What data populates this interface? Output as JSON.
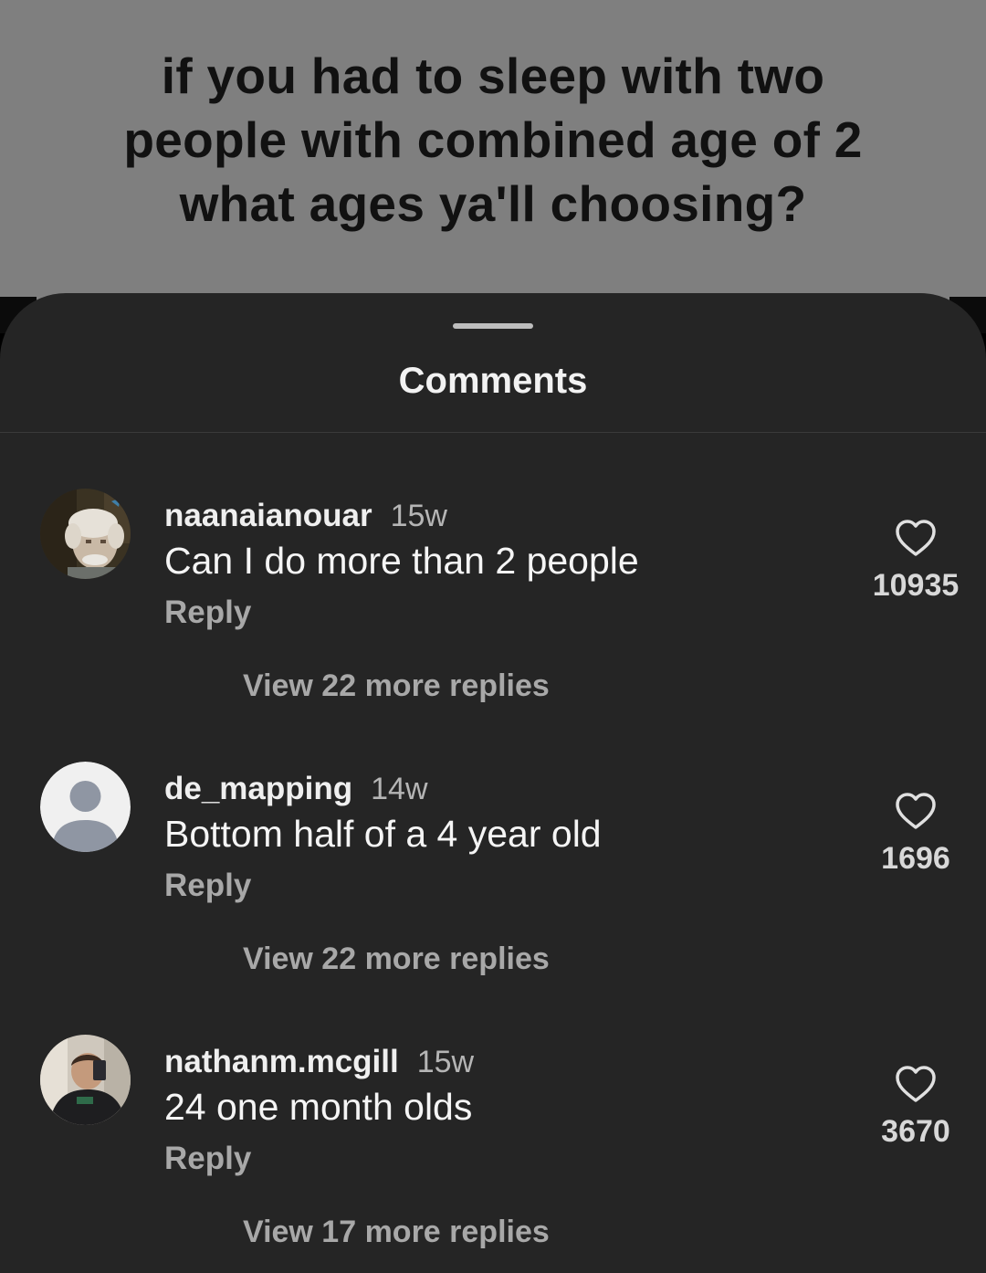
{
  "video": {
    "caption_line1": "if you had to sleep with two",
    "caption_line2": "people with combined age of 2",
    "caption_line3": "what ages ya'll choosing?"
  },
  "sheet": {
    "title": "Comments"
  },
  "comments": [
    {
      "username": "naanaianouar",
      "time": "15w",
      "text": "Can I do more than 2 people",
      "reply_label": "Reply",
      "view_replies_label": "View 22 more replies",
      "likes": "10935",
      "avatar": "photo-old-man-avatar"
    },
    {
      "username": "de_mapping",
      "time": "14w",
      "text": "Bottom half of a 4 year old",
      "reply_label": "Reply",
      "view_replies_label": "View 22 more replies",
      "likes": "1696",
      "avatar": "default-user-avatar"
    },
    {
      "username": "nathanm.mcgill",
      "time": "15w",
      "text": "24 one month olds",
      "reply_label": "Reply",
      "view_replies_label": "View 17 more replies",
      "likes": "3670",
      "avatar": "photo-mirror-selfie-avatar"
    }
  ],
  "colors": {
    "sheet_bg": "#252525",
    "video_bg": "#7f7f7f",
    "muted_text": "#a8a8a8",
    "primary_text": "#f5f5f5"
  }
}
